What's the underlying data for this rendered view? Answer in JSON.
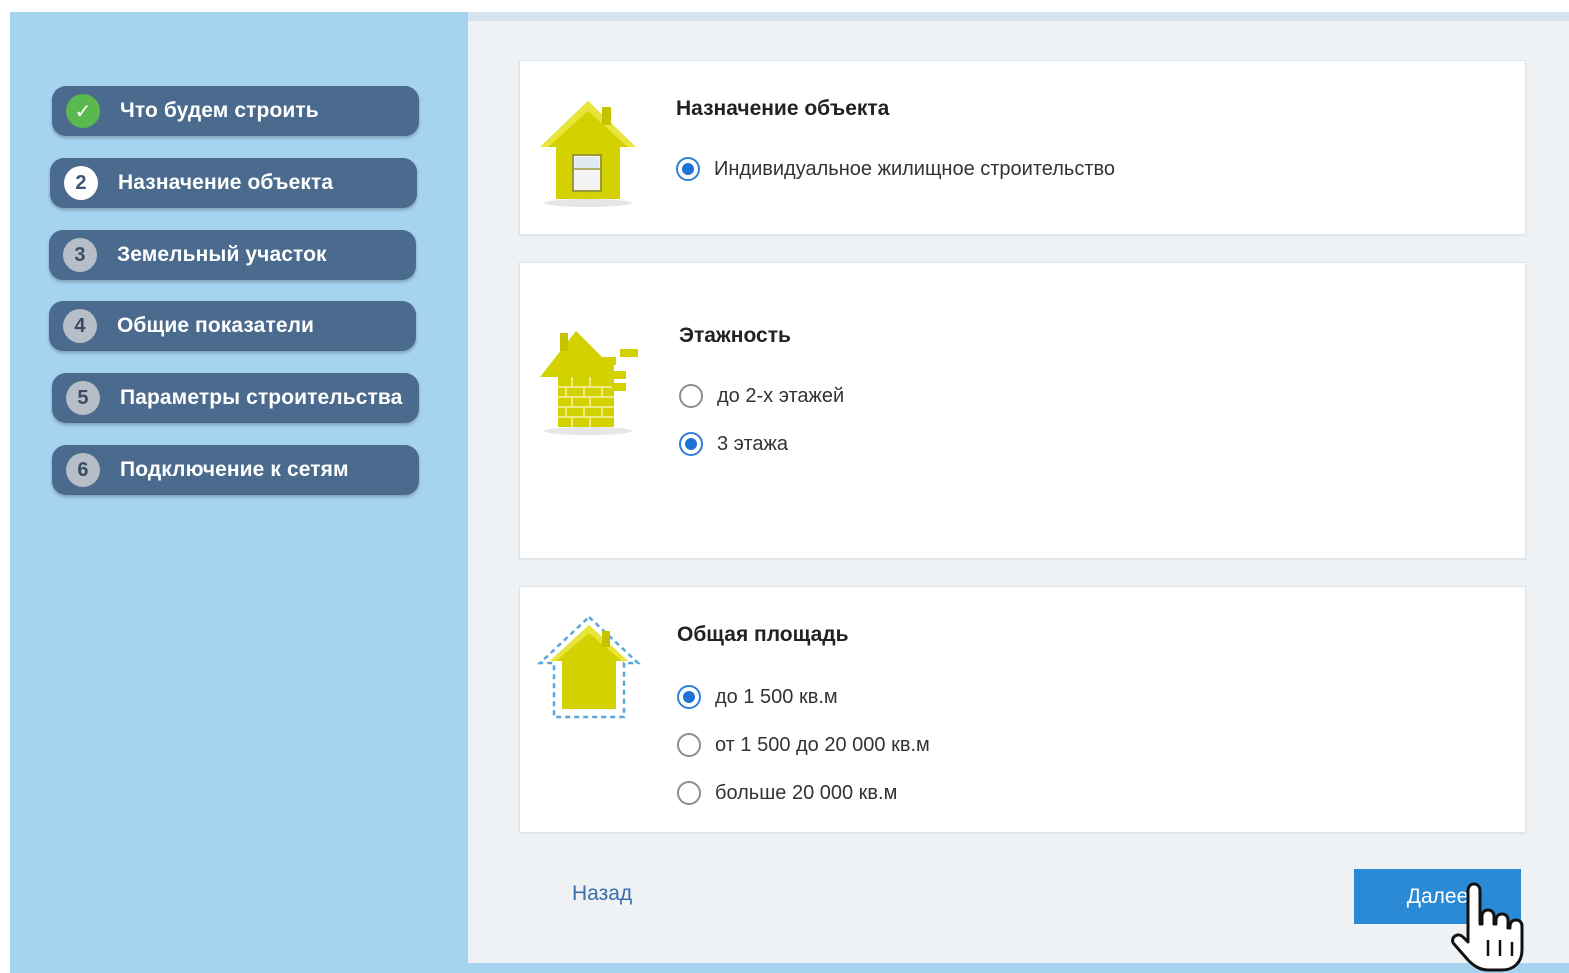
{
  "sidebar": {
    "steps": [
      {
        "badge": "✓",
        "label": "Что будем строить",
        "state": "done"
      },
      {
        "badge": "2",
        "label": "Назначение объекта",
        "state": "current"
      },
      {
        "badge": "3",
        "label": "Земельный участок",
        "state": "todo"
      },
      {
        "badge": "4",
        "label": "Общие показатели",
        "state": "todo"
      },
      {
        "badge": "5",
        "label": "Параметры строительства",
        "state": "todo"
      },
      {
        "badge": "6",
        "label": "Подключение к сетям",
        "state": "todo"
      }
    ]
  },
  "cards": [
    {
      "title": "Назначение объекта",
      "icon": "house-window-icon",
      "options": [
        {
          "label": "Индивидуальное жилищное строительство",
          "checked": true
        }
      ]
    },
    {
      "title": "Этажность",
      "icon": "brick-house-icon",
      "options": [
        {
          "label": "до 2-х этажей",
          "checked": false
        },
        {
          "label": "3 этажа",
          "checked": true
        }
      ]
    },
    {
      "title": "Общая площадь",
      "icon": "house-area-icon",
      "options": [
        {
          "label": "до 1 500 кв.м",
          "checked": true
        },
        {
          "label": "от 1 500 до 20 000 кв.м",
          "checked": false
        },
        {
          "label": "больше 20 000 кв.м",
          "checked": false
        }
      ]
    }
  ],
  "footer": {
    "back_label": "Назад",
    "next_label": "Далее"
  },
  "colors": {
    "sidebar_bg": "#a6d3ef",
    "step_bg": "#4a6a8e",
    "done_badge": "#5ab94e",
    "accent_blue": "#2b8ad6",
    "icon_yellow": "#d4d100"
  }
}
